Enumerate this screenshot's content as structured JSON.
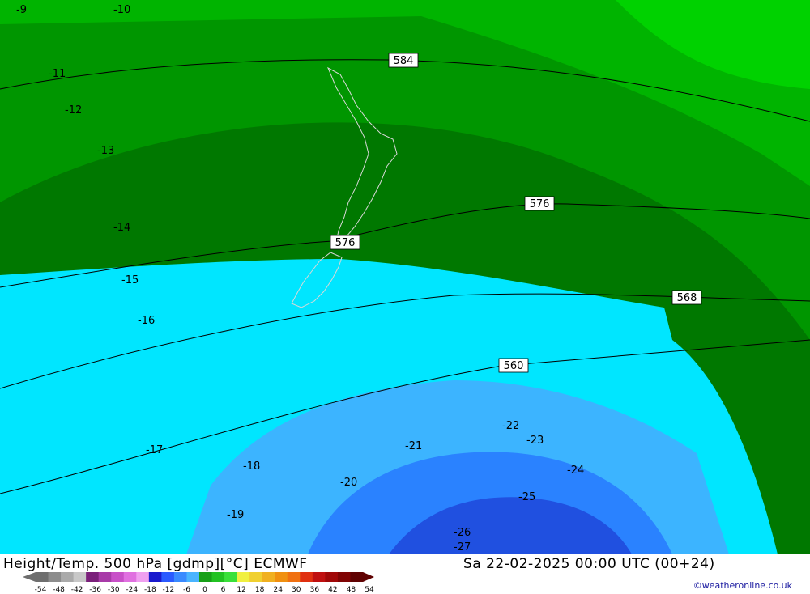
{
  "map": {
    "title": "Height/Temp. 500 hPa [gdmp][°C] ECMWF",
    "valid_time": "Sa 22-02-2025 00:00 UTC (00+24)",
    "credit": "©weatheronline.co.uk",
    "height_contour_labels": [
      "584",
      "576",
      "576",
      "568",
      "560"
    ],
    "temperature_range_labels": [
      "-9",
      "-10",
      "-11",
      "-12",
      "-13",
      "-14",
      "-15",
      "-16",
      "-17",
      "-18",
      "-19",
      "-20",
      "-21",
      "-22",
      "-23",
      "-24",
      "-25",
      "-26",
      "-27"
    ],
    "legend": {
      "tick_labels": [
        "-54",
        "-48",
        "-42",
        "-36",
        "-30",
        "-24",
        "-18",
        "-12",
        "-6",
        "0",
        "6",
        "12",
        "18",
        "24",
        "30",
        "36",
        "42",
        "48",
        "54"
      ],
      "colors": [
        "#6e6e6e",
        "#8c8c8c",
        "#aaaaaa",
        "#c8c8c8",
        "#7a1f7a",
        "#a83aa8",
        "#c850c8",
        "#e070e0",
        "#f0a0f0",
        "#1a1acd",
        "#2a5aff",
        "#3a8aff",
        "#4ab4ff",
        "#18a018",
        "#22c222",
        "#3ae03a",
        "#f0f040",
        "#f0d030",
        "#f0b020",
        "#f09010",
        "#f07010",
        "#e03010",
        "#c01010",
        "#a00808",
        "#800404",
        "#600202"
      ]
    },
    "colors": {
      "green_dark": "#007800",
      "green_mid": "#009600",
      "green_light": "#00b400",
      "green_bright": "#00d200",
      "cyan": "#00e6ff",
      "blue_light": "#3cb4ff",
      "blue_mid": "#2a82ff",
      "blue_dark": "#2050e0"
    }
  }
}
